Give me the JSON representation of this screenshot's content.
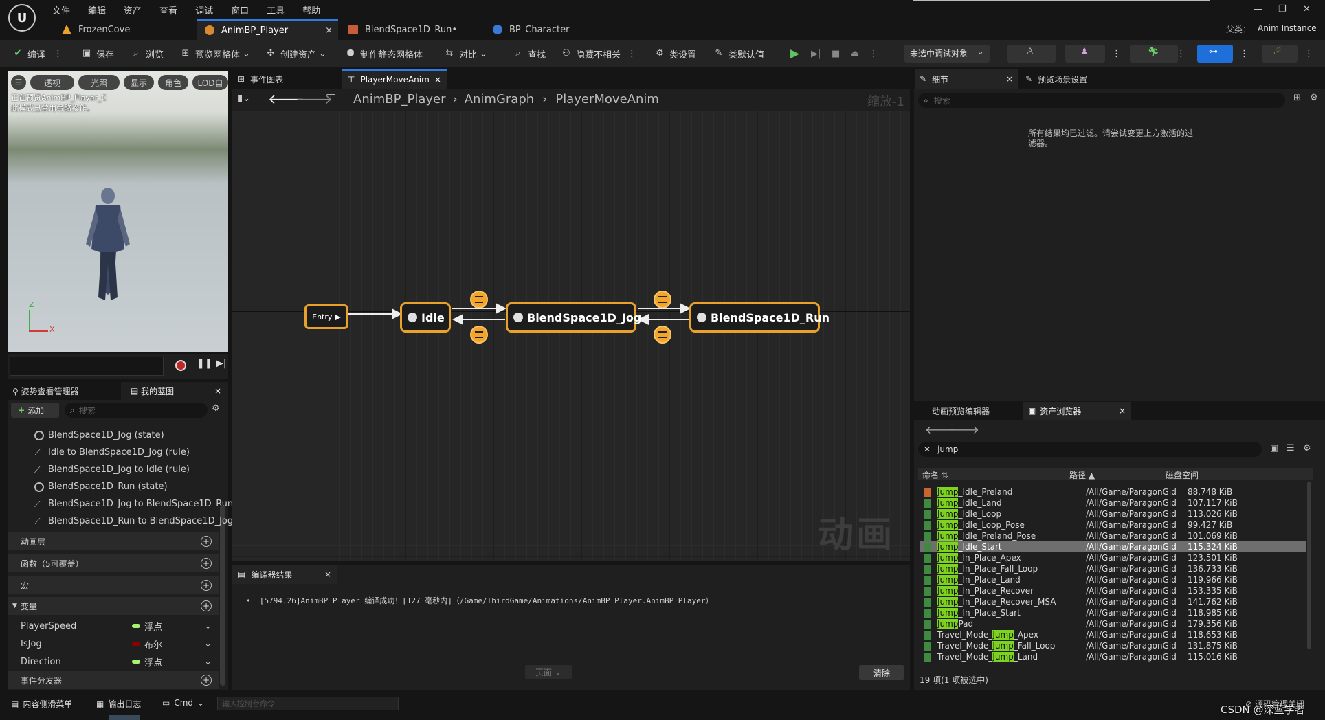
{
  "menubar": {
    "items": [
      "文件",
      "编辑",
      "资产",
      "查看",
      "调试",
      "窗口",
      "工具",
      "帮助"
    ]
  },
  "window": {
    "parent_label": "父类：",
    "parent_value": "Anim Instance",
    "min": "—",
    "restore": "❐",
    "close": "✕"
  },
  "tabs": [
    {
      "label": "FrozenCove",
      "active": false
    },
    {
      "label": "AnimBP_Player",
      "active": true,
      "close": "×"
    },
    {
      "label": "BlendSpace1D_Run•",
      "active": false
    },
    {
      "label": "BP_Character",
      "active": false
    }
  ],
  "toolbar": {
    "compile": "编译",
    "save": "保存",
    "browse": "浏览",
    "preview_mesh": "预览网格体",
    "create_asset": "创建资产",
    "make_static_mesh": "制作静态网格体",
    "diff": "对比",
    "find": "查找",
    "hide_unrelated": "隐藏不相关",
    "class_settings": "类设置",
    "class_defaults": "类默认值",
    "debug_target": "未选中调试对象"
  },
  "viewport": {
    "buttons": [
      "☰",
      "透视",
      "光照",
      "显示",
      "角色",
      "LOD自"
    ],
    "overlay_line1": "正在预览AnimBP_Player_C",
    "overlay_line2": "此模式已禁用骨骼操作。",
    "axis_z": "Z",
    "axis_x": "X"
  },
  "left_panel": {
    "tab_pose": "姿势查看管理器",
    "tab_blueprint": "我的蓝图",
    "close": "×",
    "add": "添加",
    "search_placeholder": "搜索",
    "tree_items": [
      {
        "label": "BlendSpace1D_Jog (state)",
        "type": "state"
      },
      {
        "label": "Idle to BlendSpace1D_Jog (rule)",
        "type": "rule"
      },
      {
        "label": "BlendSpace1D_Jog to Idle (rule)",
        "type": "rule"
      },
      {
        "label": "BlendSpace1D_Run (state)",
        "type": "state"
      },
      {
        "label": "BlendSpace1D_Jog to BlendSpace1D_Run",
        "type": "rule"
      },
      {
        "label": "BlendSpace1D_Run to BlendSpace1D_Jog",
        "type": "rule"
      }
    ],
    "sections": {
      "anim_layers": "动画层",
      "functions": "函数（5可覆盖）",
      "macros": "宏",
      "variables": "变量",
      "event_dispatchers": "事件分发器"
    },
    "variables": [
      {
        "name": "PlayerSpeed",
        "type": "浮点",
        "color": "#a7f36c"
      },
      {
        "name": "IsJog",
        "type": "布尔",
        "color": "#8b0000"
      },
      {
        "name": "Direction",
        "type": "浮点",
        "color": "#a7f36c"
      }
    ]
  },
  "graph_tabs": {
    "event_graph": "事件图表",
    "player_move_anim": "PlayerMoveAnim",
    "close": "×"
  },
  "breadcrumb": {
    "items": [
      "AnimBP_Player",
      "AnimGraph",
      "PlayerMoveAnim"
    ],
    "zoom": "缩放-1"
  },
  "graph": {
    "watermark": "动画",
    "nodes": {
      "entry": "Entry",
      "idle": "Idle",
      "jog": "BlendSpace1D_Jog",
      "run": "BlendSpace1D_Run"
    }
  },
  "compiler": {
    "tab": "编译器结果",
    "close": "×",
    "message": "[5794.26]AnimBP_Player 编译成功！[127 毫秒内]（/Game/ThirdGame/Animations/AnimBP_Player.AnimBP_Player）",
    "page": "页面",
    "clear": "清除"
  },
  "details": {
    "tab_details": "细节",
    "tab_preview": "预览场景设置",
    "close": "×",
    "search_placeholder": "搜索",
    "filtered_msg_line1": "所有结果均已过滤。请尝试变更上方激活的过",
    "filtered_msg_line2": "滤器。"
  },
  "asset_browser": {
    "tab_anim_preview": "动画预览编辑器",
    "tab_assets": "资产浏览器",
    "close": "×",
    "search_value": "jump",
    "col_name": "命名",
    "col_path": "路径",
    "col_size": "磁盘空间",
    "rows": [
      {
        "pre": "",
        "hl": "Jump",
        "post": "_Idle_Preland",
        "path": "/All/Game/ParagonGid",
        "size": "88.748 KiB",
        "selected": false
      },
      {
        "pre": "",
        "hl": "Jump",
        "post": "_Idle_Land",
        "path": "/All/Game/ParagonGid",
        "size": "107.117 KiB",
        "selected": false
      },
      {
        "pre": "",
        "hl": "Jump",
        "post": "_Idle_Loop",
        "path": "/All/Game/ParagonGid",
        "size": "113.026 KiB",
        "selected": false
      },
      {
        "pre": "",
        "hl": "Jump",
        "post": "_Idle_Loop_Pose",
        "path": "/All/Game/ParagonGid",
        "size": "99.427 KiB",
        "selected": false
      },
      {
        "pre": "",
        "hl": "Jump",
        "post": "_Idle_Preland_Pose",
        "path": "/All/Game/ParagonGid",
        "size": "101.069 KiB",
        "selected": false
      },
      {
        "pre": "",
        "hl": "Jump",
        "post": "_Idle_Start",
        "path": "/All/Game/ParagonGid",
        "size": "115.324 KiB",
        "selected": true
      },
      {
        "pre": "",
        "hl": "Jump",
        "post": "_In_Place_Apex",
        "path": "/All/Game/ParagonGid",
        "size": "123.501 KiB",
        "selected": false
      },
      {
        "pre": "",
        "hl": "Jump",
        "post": "_In_Place_Fall_Loop",
        "path": "/All/Game/ParagonGid",
        "size": "136.733 KiB",
        "selected": false
      },
      {
        "pre": "",
        "hl": "Jump",
        "post": "_In_Place_Land",
        "path": "/All/Game/ParagonGid",
        "size": "119.966 KiB",
        "selected": false
      },
      {
        "pre": "",
        "hl": "Jump",
        "post": "_In_Place_Recover",
        "path": "/All/Game/ParagonGid",
        "size": "153.335 KiB",
        "selected": false
      },
      {
        "pre": "",
        "hl": "Jump",
        "post": "_In_Place_Recover_MSA",
        "path": "/All/Game/ParagonGid",
        "size": "141.762 KiB",
        "selected": false
      },
      {
        "pre": "",
        "hl": "Jump",
        "post": "_In_Place_Start",
        "path": "/All/Game/ParagonGid",
        "size": "118.985 KiB",
        "selected": false
      },
      {
        "pre": "",
        "hl": "Jump",
        "post": "Pad",
        "path": "/All/Game/ParagonGid",
        "size": "179.356 KiB",
        "selected": false
      },
      {
        "pre": "Travel_Mode_",
        "hl": "Jump",
        "post": "_Apex",
        "path": "/All/Game/ParagonGid",
        "size": "118.653 KiB",
        "selected": false
      },
      {
        "pre": "Travel_Mode_",
        "hl": "Jump",
        "post": "_Fall_Loop",
        "path": "/All/Game/ParagonGid",
        "size": "131.875 KiB",
        "selected": false
      },
      {
        "pre": "Travel_Mode_",
        "hl": "Jump",
        "post": "_Land",
        "path": "/All/Game/ParagonGid",
        "size": "115.016 KiB",
        "selected": false
      }
    ],
    "status": "19 项(1 项被选中)"
  },
  "statusbar": {
    "content_drawer": "内容侧滑菜单",
    "output_log": "输出日志",
    "cmd": "Cmd",
    "console_placeholder": "输入控制台命令",
    "source_control": "源码管理关闭",
    "watermark": "CSDN @深蓝学者"
  }
}
